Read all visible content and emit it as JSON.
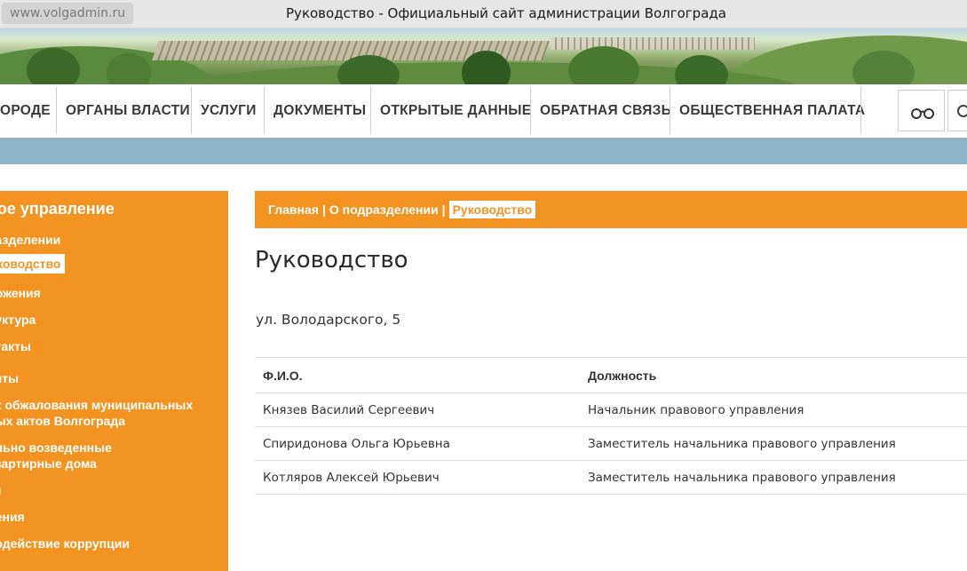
{
  "browser": {
    "url": "www.volgadmin.ru",
    "window_title": "Руководство - Официальный сайт администрации Волгограда"
  },
  "nav": {
    "items": [
      {
        "label": "ОРОДЕ"
      },
      {
        "label": "ОРГАНЫ ВЛАСТИ"
      },
      {
        "label": "УСЛУГИ"
      },
      {
        "label": "ДОКУМЕНТЫ"
      },
      {
        "label": "ОТКРЫТЫЕ ДАННЫЕ"
      },
      {
        "label": "ОБРАТНАЯ СВЯЗЬ"
      },
      {
        "label": "ОБЩЕСТВЕННАЯ ПАЛАТА"
      }
    ],
    "accessibility_icon": "glasses-icon",
    "search_icon": "search-icon"
  },
  "sidebar": {
    "title": "вое управление",
    "items": [
      {
        "label": "разделении"
      },
      {
        "label": "ководство",
        "active": true
      },
      {
        "label": "ложения"
      },
      {
        "label": "руктура"
      },
      {
        "label": "нтакты"
      },
      {
        "label": "енты"
      },
      {
        "label": "ок обжалования муниципальных"
      },
      {
        "label": "вых актов Волгограда"
      },
      {
        "label": "ольно возведенные"
      },
      {
        "label": "квартирные дома"
      },
      {
        "label": "ти"
      },
      {
        "label": "ления"
      },
      {
        "label": "водействие коррупции"
      }
    ]
  },
  "breadcrumb": {
    "home": "Главная",
    "sep": "|",
    "parent": "О подразделении",
    "current": "Руководство"
  },
  "main": {
    "title": "Руководство",
    "address": "ул. Володарского, 5",
    "table": {
      "headers": [
        "Ф.И.О.",
        "Должность"
      ],
      "rows": [
        [
          "Князев Василий Сергеевич",
          "Начальник правового управления"
        ],
        [
          "Спиридонова Ольга Юрьевна",
          "Заместитель начальника правового управления"
        ],
        [
          "Котляров Алексей Юрьевич",
          "Заместитель начальника правового управления"
        ]
      ]
    }
  },
  "colors": {
    "accent": "#f39422",
    "band": "#8fb3c8"
  }
}
